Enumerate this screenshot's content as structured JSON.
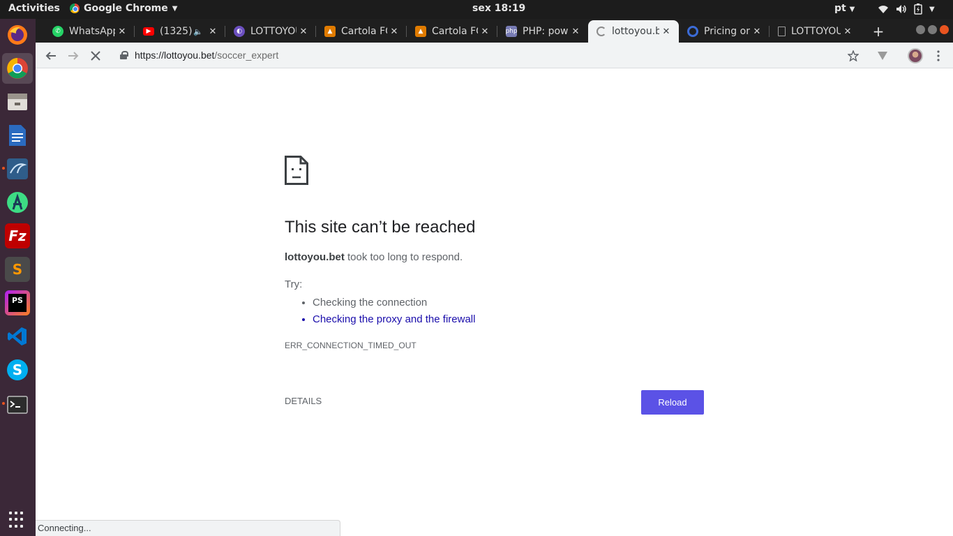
{
  "topbar": {
    "activities": "Activities",
    "app_name": "Google Chrome",
    "clock": "sex 18:19",
    "language": "pt"
  },
  "dock": {
    "items": [
      "firefox-icon",
      "chrome-icon",
      "files-icon",
      "libreoffice-writer-icon",
      "mysql-workbench-icon",
      "android-studio-icon",
      "filezilla-icon",
      "sublime-text-icon",
      "phpstorm-icon",
      "vscode-icon",
      "skype-icon",
      "terminal-icon"
    ]
  },
  "tabs": [
    {
      "title": "WhatsApp",
      "icon": "whatsapp-icon",
      "color": "#25d366"
    },
    {
      "title": "(1325)",
      "icon": "youtube-icon",
      "color": "#ff0000",
      "audio": true
    },
    {
      "title": "LOTTOYOU",
      "icon": "lottoyou-icon",
      "color": "#6b4fbf"
    },
    {
      "title": "Cartola FC",
      "icon": "cartola-icon",
      "color": "#e07b00"
    },
    {
      "title": "Cartola FC",
      "icon": "cartola-icon",
      "color": "#e07b00"
    },
    {
      "title": "PHP: pow",
      "icon": "php-icon",
      "color": "#777bb3"
    },
    {
      "title": "lottoyou.b",
      "icon": "loading-spinner-icon",
      "color": "#8a8a8a",
      "active": true
    },
    {
      "title": "Pricing or",
      "icon": "pricing-icon",
      "color": "#3b6bd6"
    },
    {
      "title": "LOTTOYOU",
      "icon": "page-icon",
      "color": "#9e9e9e"
    }
  ],
  "toolbar": {
    "url_host": "https://lottoyou.bet",
    "url_path": "/soccer_expert"
  },
  "error_page": {
    "title": "This site can’t be reached",
    "host": "lottoyou.bet",
    "desc_suffix": " took too long to respond.",
    "try_label": "Try:",
    "suggestion_1": "Checking the connection",
    "suggestion_2": "Checking the proxy and the firewall",
    "error_code": "ERR_CONNECTION_TIMED_OUT",
    "details_label": "DETAILS",
    "reload_label": "Reload",
    "accent_color": "#5b52e6"
  },
  "statusbar": {
    "text": "Connecting..."
  }
}
